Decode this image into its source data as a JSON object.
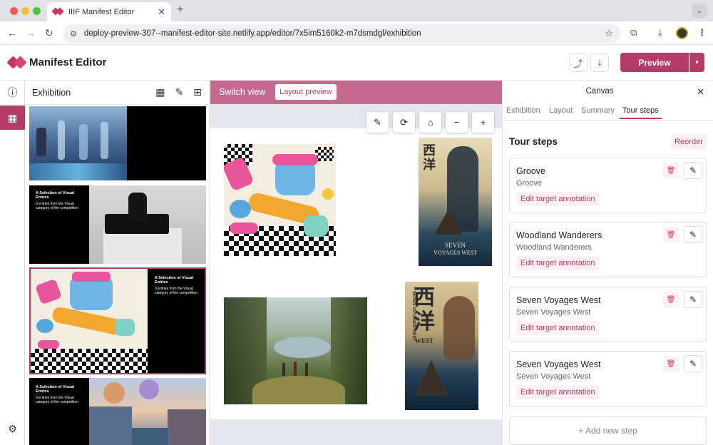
{
  "browser": {
    "tab_title": "IIIF Manifest Editor",
    "url": "deploy-preview-307--manifest-editor-site.netlify.app/editor/7x5im5160k2-m7dsmdgl/exhibition"
  },
  "header": {
    "app_title": "Manifest Editor",
    "preview_label": "Preview"
  },
  "exhibition_panel": {
    "title": "Exhibition",
    "thumbnails": [
      {
        "caption_title": "",
        "caption_text": ""
      },
      {
        "caption_title": "A Selection of Visual Entries",
        "caption_text": "3 entries from the Visual category of the competition"
      },
      {
        "caption_title": "A Selection of Visual Entries",
        "caption_text": "3 entries from the Visual category of the competition"
      },
      {
        "caption_title": "A Selection of Visual Entries",
        "caption_text": "3 entries from the Visual category of the competition"
      }
    ]
  },
  "center": {
    "switch_view_label": "Switch view",
    "layout_preview_label": "Layout preview"
  },
  "poster": {
    "top_title_line1": "SEVEN",
    "top_title_line2": "VOYAGES WEST",
    "top_glyphs": "西洋",
    "bottom_glyphs": "西洋",
    "bottom_word": "WEST",
    "bottom_side_text": "SEVEN VOYAGES WEST"
  },
  "right_panel": {
    "title": "Canvas",
    "tabs": [
      "Exhibition",
      "Layout",
      "Summary",
      "Tour steps"
    ],
    "active_tab": "Tour steps",
    "section_title": "Tour steps",
    "reorder_label": "Reorder",
    "edit_target_label": "Edit target annotation",
    "steps": [
      {
        "title": "Groove",
        "subtitle": "Groove"
      },
      {
        "title": "Woodland Wanderers",
        "subtitle": "Woodland Wanderers"
      },
      {
        "title": "Seven Voyages West",
        "subtitle": "Seven Voyages West"
      },
      {
        "title": "Seven Voyages West",
        "subtitle": "Seven Voyages West"
      }
    ],
    "add_step_label": "+ Add new step"
  },
  "colors": {
    "accent": "#b33c68",
    "switch_bar": "#c56990",
    "accent_soft": "#fdf0f4"
  }
}
